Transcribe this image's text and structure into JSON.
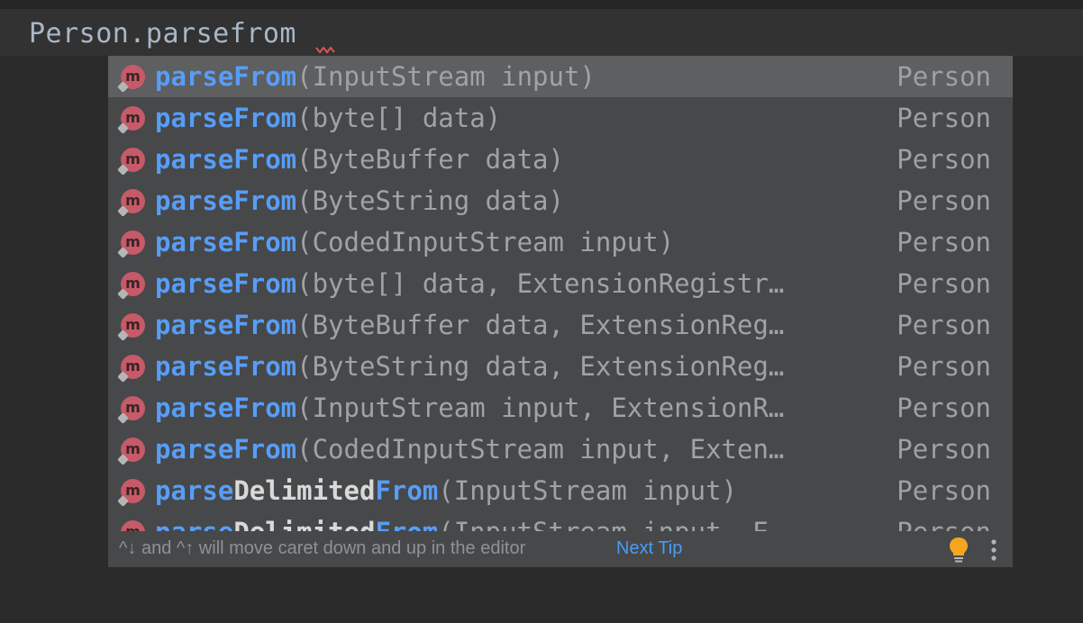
{
  "editor": {
    "code_text": "Person.parsefrom"
  },
  "completion": {
    "items": [
      {
        "name_a": "parseFrom",
        "name_b": "",
        "name_c": "",
        "params": "(InputStream input)",
        "type": "Person",
        "selected": true
      },
      {
        "name_a": "parseFrom",
        "name_b": "",
        "name_c": "",
        "params": "(byte[] data)",
        "type": "Person"
      },
      {
        "name_a": "parseFrom",
        "name_b": "",
        "name_c": "",
        "params": "(ByteBuffer data)",
        "type": "Person"
      },
      {
        "name_a": "parseFrom",
        "name_b": "",
        "name_c": "",
        "params": "(ByteString data)",
        "type": "Person"
      },
      {
        "name_a": "parseFrom",
        "name_b": "",
        "name_c": "",
        "params": "(CodedInputStream input)",
        "type": "Person"
      },
      {
        "name_a": "parseFrom",
        "name_b": "",
        "name_c": "",
        "params": "(byte[] data, ExtensionRegistr…",
        "type": "Person"
      },
      {
        "name_a": "parseFrom",
        "name_b": "",
        "name_c": "",
        "params": "(ByteBuffer data, ExtensionReg…",
        "type": "Person"
      },
      {
        "name_a": "parseFrom",
        "name_b": "",
        "name_c": "",
        "params": "(ByteString data, ExtensionReg…",
        "type": "Person"
      },
      {
        "name_a": "parseFrom",
        "name_b": "",
        "name_c": "",
        "params": "(InputStream input, ExtensionR…",
        "type": "Person"
      },
      {
        "name_a": "parseFrom",
        "name_b": "",
        "name_c": "",
        "params": "(CodedInputStream input, Exten…",
        "type": "Person"
      },
      {
        "name_a": "parse",
        "name_b": "Delimited",
        "name_c": "From",
        "params": "(InputStream input)",
        "type": "Person"
      },
      {
        "name_a": "parse",
        "name_b": "Delimited",
        "name_c": "From",
        "params": "(InputStream input, E…",
        "type": "Person"
      }
    ],
    "method_badge_letter": "m",
    "footer": {
      "tip_text": "^↓ and ^↑ will move caret down and up in the editor",
      "next_tip_label": "Next Tip"
    }
  },
  "icons": {
    "method": "method-icon",
    "bulb": "lightbulb-icon",
    "more": "more-vertical-icon"
  },
  "colors": {
    "editor_bg": "#2b2b2b",
    "popup_bg": "#46484a",
    "selected_bg": "#5d5f61",
    "match_blue": "#589df6",
    "badge_red": "#c65a68",
    "bulb_yellow": "#f4a61f",
    "link_blue": "#4c9bf5"
  }
}
